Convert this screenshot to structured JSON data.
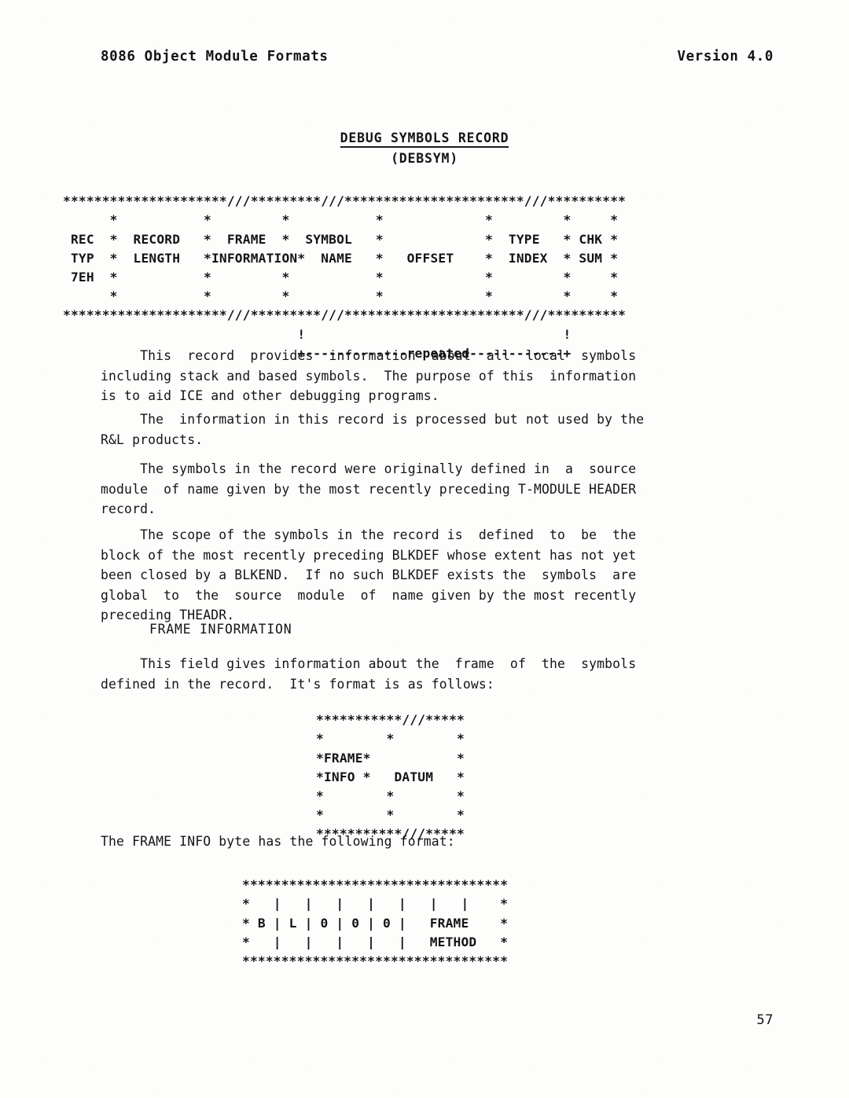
{
  "header": {
    "left": "8086 Object Module Formats",
    "right": "Version 4.0"
  },
  "record_title": {
    "main": "DEBUG SYMBOLS RECORD",
    "sub": "(DEBSYM)"
  },
  "diagrams": {
    "record_layout": {
      "fields": [
        "REC TYP 7EH",
        "RECORD LENGTH",
        "FRAME INFORMATION",
        "SYMBOL NAME",
        "OFFSET",
        "TYPE INDEX",
        "CHK SUM"
      ],
      "repeat_label": "repeated",
      "art": "*********************///*********///***********************///**********\n      *           *         *           *             *         *     *\n REC  *  RECORD   *  FRAME  *  SYMBOL   *             *  TYPE   * CHK *\n TYP  *  LENGTH   *INFORMATION*  NAME   *   OFFSET    *  INDEX  * SUM *\n 7EH  *           *         *           *             *         *     *\n      *           *         *           *             *         *     *\n*********************///*********///***********************///**********\n                              !                                 !\n                              +-------------repeated------------+"
    },
    "frame_info_field": {
      "fields": [
        "FRAME INFO",
        "DATUM"
      ],
      "art": "***********///*****\n*        *        *\n*FRAME*           *\n*INFO *   DATUM   *\n*        *        *\n*        *        *\n***********///*****"
    },
    "frame_info_byte": {
      "bits": [
        "B",
        "L",
        "0",
        "0",
        "0",
        "FRAME METHOD"
      ],
      "art": "**********************************\n*   |   |   |   |   |   |   |    *\n* B | L | 0 | 0 | 0 |   FRAME    *\n*   |   |   |   |   |   METHOD   *\n**********************************"
    }
  },
  "paragraphs": {
    "p1": "     This  record  provides  information  about  all  local  symbols\nincluding stack and based symbols.  The purpose of this  information\nis to aid ICE and other debugging programs.",
    "p2": "     The  information in this record is processed but not used by the\nR&L products.",
    "p3": "     The symbols in the record were originally defined in  a  source\nmodule  of name given by the most recently preceding T-MODULE HEADER\nrecord.",
    "p4": "     The scope of the symbols in the record is  defined  to  be  the\nblock of the most recently preceding BLKDEF whose extent has not yet\nbeen closed by a BLKEND.  If no such BLKDEF exists the  symbols  are\nglobal  to  the  source  module  of  name given by the most recently\npreceding THEADR.",
    "p5": "     This field gives information about the  frame  of  the  symbols\ndefined in the record.  It's format is as follows:",
    "p6": "The FRAME INFO byte has the following format:"
  },
  "subheading": "FRAME INFORMATION",
  "folio": "57"
}
